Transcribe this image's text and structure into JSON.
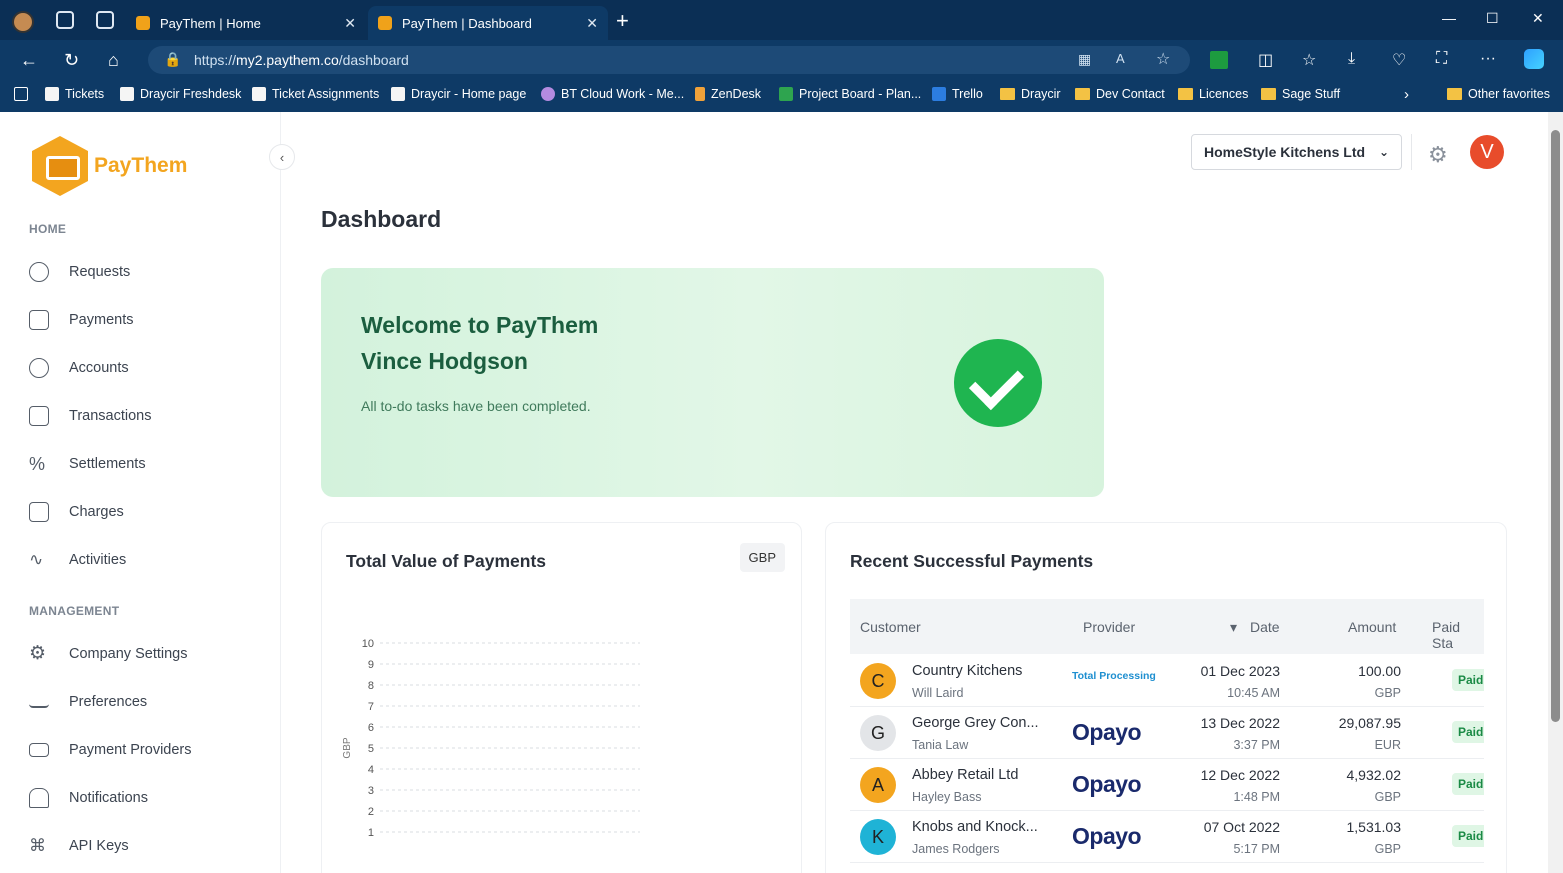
{
  "browser": {
    "tabs": [
      {
        "label": "PayThem | Home"
      },
      {
        "label": "PayThem | Dashboard"
      }
    ],
    "url_prefix": "https://",
    "url_domain": "my2.paythem.co",
    "url_path": "/dashboard",
    "bookmarks": [
      {
        "label": "Tickets"
      },
      {
        "label": "Draycir Freshdesk"
      },
      {
        "label": "Ticket Assignments"
      },
      {
        "label": "Draycir - Home page"
      },
      {
        "label": "BT Cloud Work - Me..."
      },
      {
        "label": "ZenDesk"
      },
      {
        "label": "Project Board - Plan..."
      },
      {
        "label": "Trello"
      },
      {
        "label": "Draycir"
      },
      {
        "label": "Dev Contact"
      },
      {
        "label": "Licences"
      },
      {
        "label": "Sage Stuff"
      }
    ],
    "other_favorites": "Other favorites"
  },
  "brand": {
    "name": "PayThem",
    "color": "#f3a51f"
  },
  "sidebar": {
    "home_section": "HOME",
    "home_items": [
      {
        "label": "Requests",
        "icon": "requests-icon"
      },
      {
        "label": "Payments",
        "icon": "payments-icon"
      },
      {
        "label": "Accounts",
        "icon": "accounts-icon"
      },
      {
        "label": "Transactions",
        "icon": "transactions-icon"
      },
      {
        "label": "Settlements",
        "icon": "percent-icon"
      },
      {
        "label": "Charges",
        "icon": "calculator-icon"
      },
      {
        "label": "Activities",
        "icon": "activity-icon"
      }
    ],
    "management_section": "MANAGEMENT",
    "management_items": [
      {
        "label": "Company Settings",
        "icon": "gear-icon"
      },
      {
        "label": "Preferences",
        "icon": "sliders-icon"
      },
      {
        "label": "Payment Providers",
        "icon": "card-icon"
      },
      {
        "label": "Notifications",
        "icon": "bell-icon"
      },
      {
        "label": "API Keys",
        "icon": "network-icon"
      }
    ]
  },
  "header": {
    "company_select": "HomeStyle Kitchens Ltd",
    "user_initial": "V"
  },
  "page": {
    "title": "Dashboard"
  },
  "welcome": {
    "line1": "Welcome to PayThem",
    "line2": "Vince Hodgson",
    "message": "All to-do tasks have been completed."
  },
  "payments_card": {
    "title": "Total Value of Payments",
    "currency": "GBP"
  },
  "chart_data": {
    "type": "bar",
    "title": "Total Value of Payments",
    "categories": [],
    "values": [],
    "ylabel": "GBP",
    "ylim": [
      0,
      10
    ],
    "y_ticks": [
      1,
      2,
      3,
      4,
      5,
      6,
      7,
      8,
      9,
      10
    ],
    "grid": true
  },
  "recent_card": {
    "title": "Recent Successful Payments",
    "columns": {
      "customer": "Customer",
      "provider": "Provider",
      "date": "Date",
      "amount": "Amount",
      "status": "Paid Sta"
    },
    "rows": [
      {
        "initial": "C",
        "customer": "Country Kitchens",
        "contact": "Will Laird",
        "provider": "Total Processing",
        "date": "01 Dec 2023",
        "time": "10:45 AM",
        "amount": "100.00",
        "currency": "GBP",
        "status": "Paid",
        "color": "#f3a51f"
      },
      {
        "initial": "G",
        "customer": "George Grey Con...",
        "contact": "Tania Law",
        "provider": "Opayo",
        "date": "13 Dec 2022",
        "time": "3:37 PM",
        "amount": "29,087.95",
        "currency": "EUR",
        "status": "Paid",
        "color": "#e3e5e8"
      },
      {
        "initial": "A",
        "customer": "Abbey Retail Ltd",
        "contact": "Hayley Bass",
        "provider": "Opayo",
        "date": "12 Dec 2022",
        "time": "1:48 PM",
        "amount": "4,932.02",
        "currency": "GBP",
        "status": "Paid",
        "color": "#f3a51f"
      },
      {
        "initial": "K",
        "customer": "Knobs and Knock...",
        "contact": "James Rodgers",
        "provider": "Opayo",
        "date": "07 Oct 2022",
        "time": "5:17 PM",
        "amount": "1,531.03",
        "currency": "GBP",
        "status": "Paid",
        "color": "#1fb3d6"
      }
    ]
  }
}
